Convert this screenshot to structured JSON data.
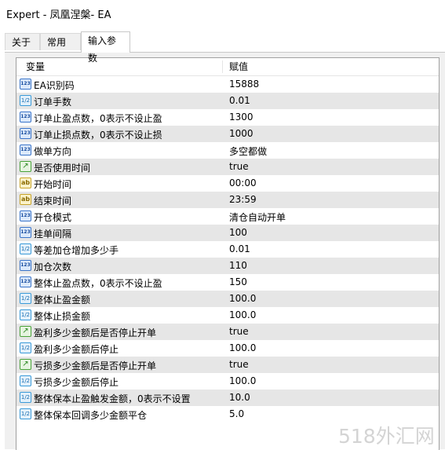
{
  "window": {
    "title": "Expert - 凤凰涅槃- EA"
  },
  "tabs": [
    {
      "label": "关于"
    },
    {
      "label": "常用"
    },
    {
      "label": "输入参数"
    }
  ],
  "table": {
    "columns": {
      "variable": "变量",
      "value": "赋值"
    },
    "rows": [
      {
        "type": "int-icon",
        "icon_text": "123",
        "name": "EA识别码",
        "value": "15888"
      },
      {
        "type": "double-icon",
        "icon_text": "1/2",
        "name": "订单手数",
        "value": "0.01"
      },
      {
        "type": "int-icon",
        "icon_text": "123",
        "name": "订单止盈点数，0表示不设止盈",
        "value": "1300"
      },
      {
        "type": "int-icon",
        "icon_text": "123",
        "name": "订单止损点数，0表示不设止损",
        "value": "1000"
      },
      {
        "type": "enum-icon",
        "icon_text": "123",
        "name": "做单方向",
        "value": "多空都做"
      },
      {
        "type": "bool-icon",
        "icon_text": "↗",
        "name": "是否使用时间",
        "value": "true"
      },
      {
        "type": "string-icon",
        "icon_text": "ab",
        "name": "开始时间",
        "value": "00:00"
      },
      {
        "type": "string-icon",
        "icon_text": "ab",
        "name": "结束时间",
        "value": "23:59"
      },
      {
        "type": "enum-icon",
        "icon_text": "123",
        "name": "开仓模式",
        "value": "清仓自动开单"
      },
      {
        "type": "int-icon",
        "icon_text": "123",
        "name": "挂单间隔",
        "value": "100"
      },
      {
        "type": "double-icon",
        "icon_text": "1/2",
        "name": "等差加仓增加多少手",
        "value": "0.01"
      },
      {
        "type": "int-icon",
        "icon_text": "123",
        "name": "加仓次数",
        "value": "110"
      },
      {
        "type": "int-icon",
        "icon_text": "123",
        "name": "整体止盈点数，0表示不设止盈",
        "value": "150"
      },
      {
        "type": "double-icon",
        "icon_text": "1/2",
        "name": "整体止盈金额",
        "value": "100.0"
      },
      {
        "type": "double-icon",
        "icon_text": "1/2",
        "name": "整体止损金额",
        "value": "100.0"
      },
      {
        "type": "bool-icon",
        "icon_text": "↗",
        "name": "盈利多少金额后是否停止开单",
        "value": "true"
      },
      {
        "type": "double-icon",
        "icon_text": "1/2",
        "name": "盈利多少金额后停止",
        "value": "100.0"
      },
      {
        "type": "bool-icon",
        "icon_text": "↗",
        "name": "亏损多少金额后是否停止开单",
        "value": "true"
      },
      {
        "type": "double-icon",
        "icon_text": "1/2",
        "name": "亏损多少金额后停止",
        "value": "100.0"
      },
      {
        "type": "double-icon",
        "icon_text": "1/2",
        "name": "整体保本止盈触发金额，0表示不设置",
        "value": "10.0"
      },
      {
        "type": "double-icon",
        "icon_text": "1/2",
        "name": "整体保本回调多少金额平仓",
        "value": "5.0"
      }
    ]
  },
  "watermark": "518外汇网"
}
